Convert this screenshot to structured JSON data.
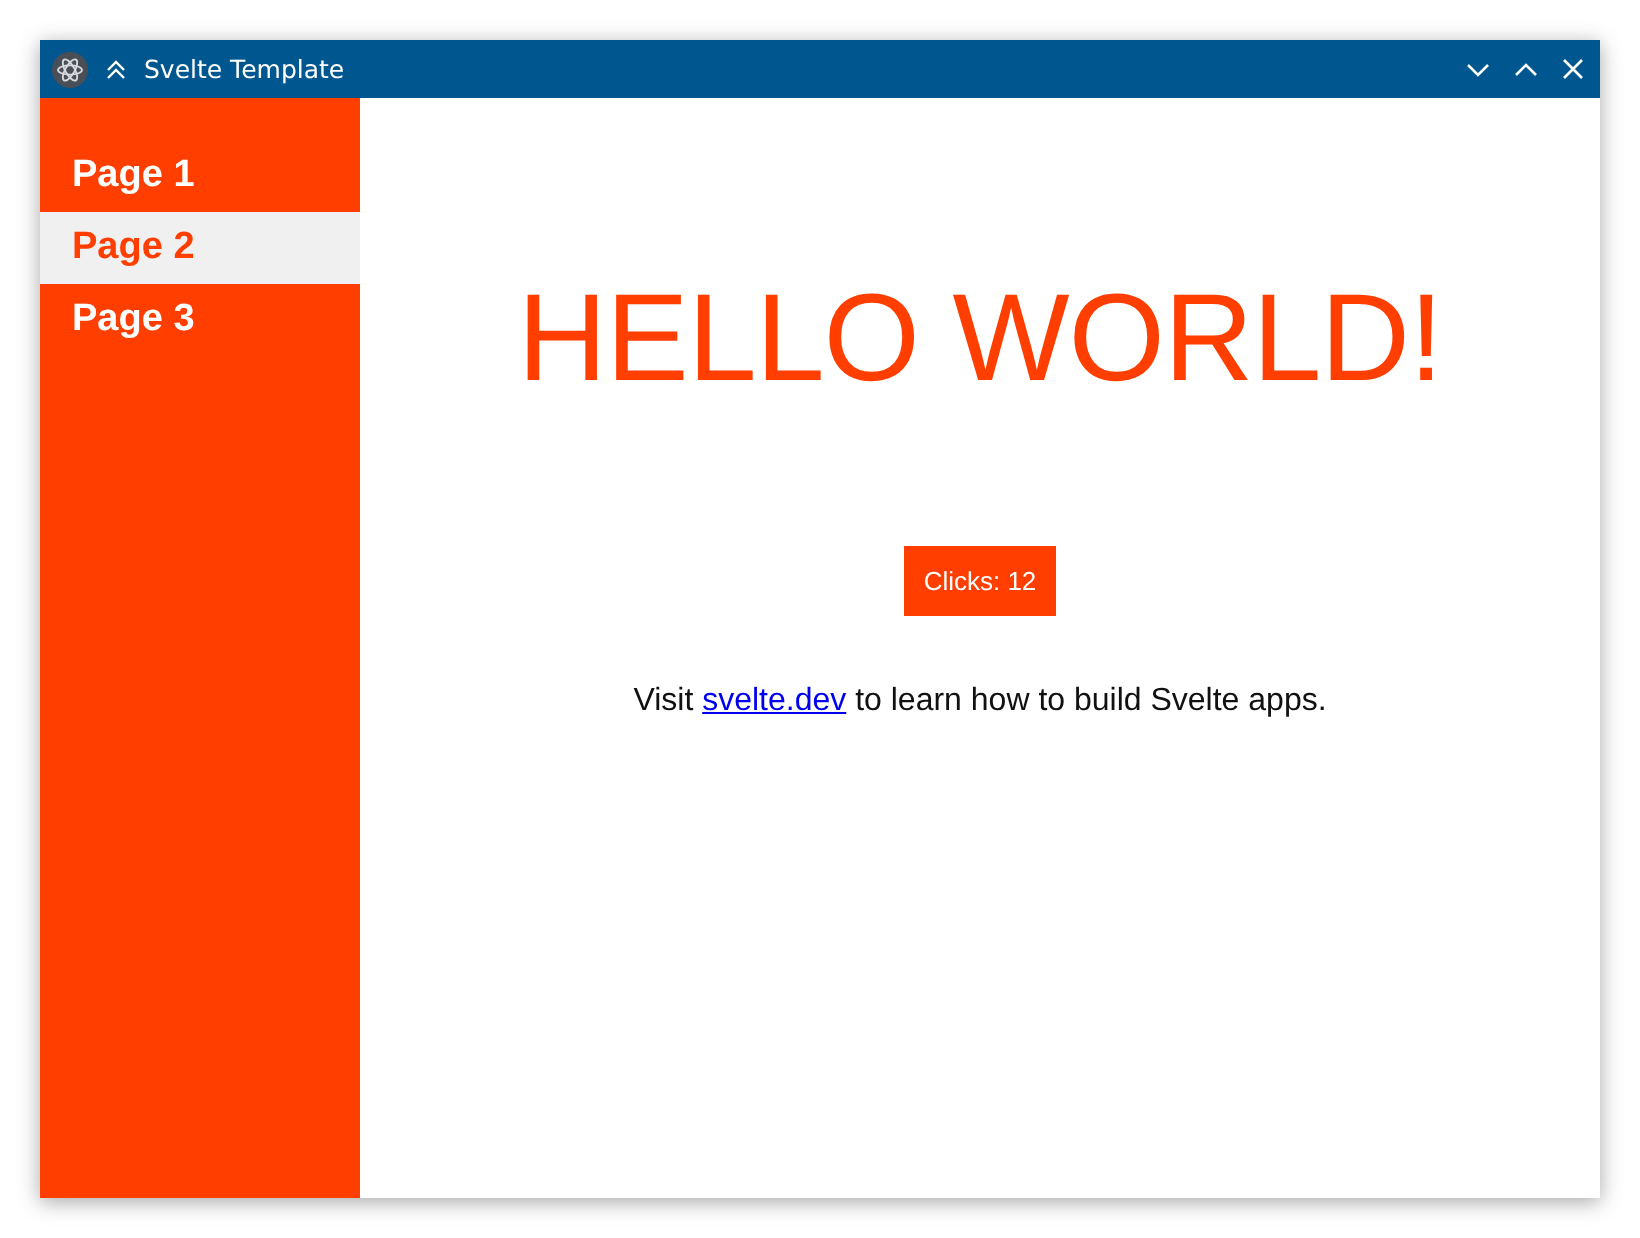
{
  "window": {
    "title": "Svelte Template"
  },
  "sidebar": {
    "items": [
      {
        "label": "Page 1",
        "selected": false
      },
      {
        "label": "Page 2",
        "selected": true
      },
      {
        "label": "Page 3",
        "selected": false
      }
    ]
  },
  "main": {
    "heading": "HELLO WORLD!",
    "button": "Clicks: 12",
    "note": {
      "before": "Visit ",
      "link": "svelte.dev",
      "after": " to learn how to build Svelte apps."
    }
  }
}
